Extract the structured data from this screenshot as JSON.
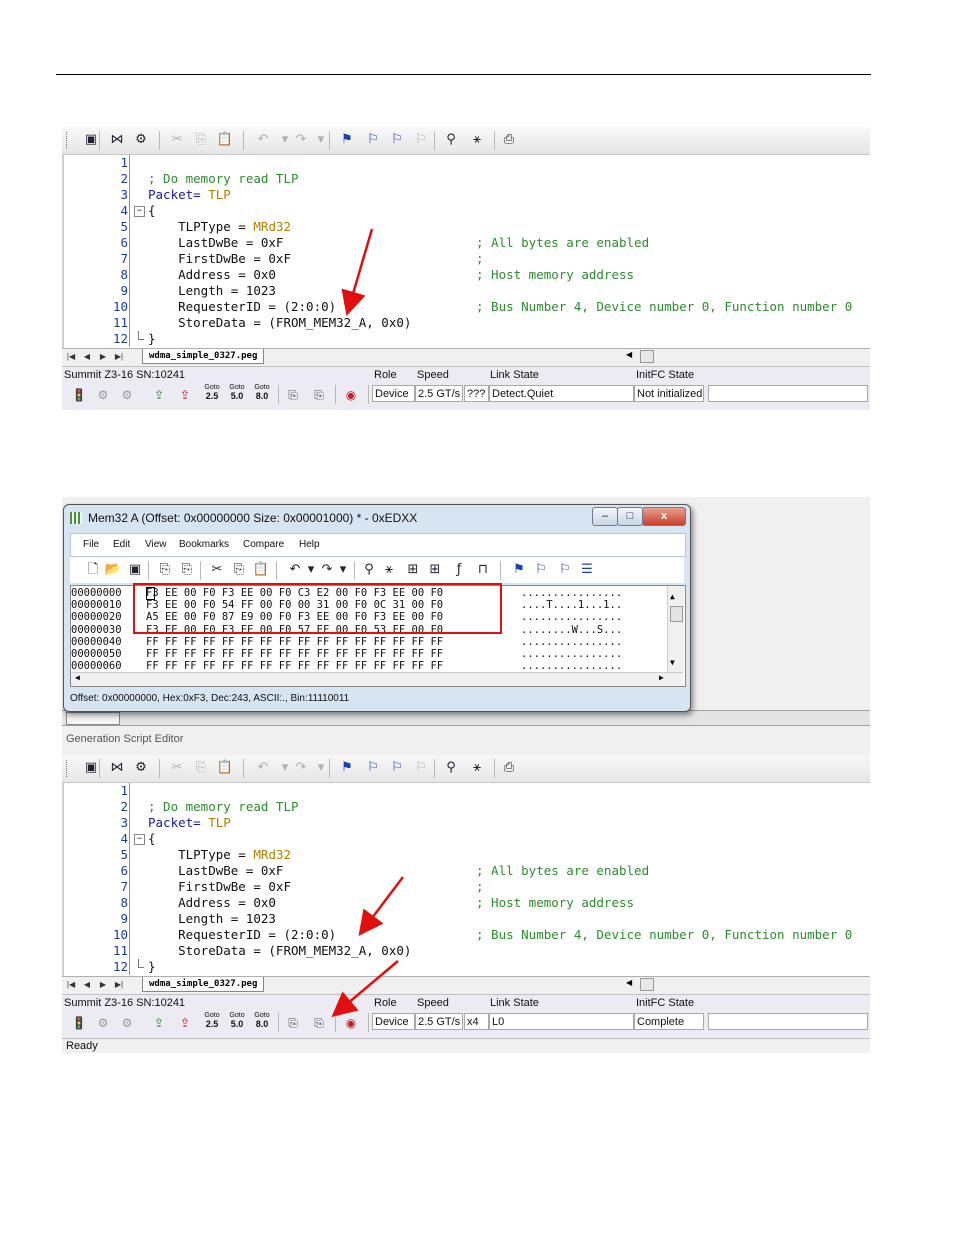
{
  "page": {
    "divider": true
  },
  "toolbar": {
    "icons": [
      "save-icon",
      "bowtie-icon",
      "build-icon",
      "cut-icon",
      "copy-icon",
      "paste-icon",
      "undo-icon",
      "undo-dropdown-icon",
      "redo-icon",
      "redo-dropdown-icon",
      "flag-icon",
      "flag-next-icon",
      "flag-prev-icon",
      "flag-clear-icon",
      "find-icon",
      "find-replace-icon",
      "print-icon"
    ]
  },
  "code": {
    "lines": [
      {
        "n": "1",
        "text": "",
        "comment": ""
      },
      {
        "n": "2",
        "text": "; Do memory read TLP",
        "comment": ""
      },
      {
        "n": "3",
        "text": "Packet= ",
        "value": "TLP",
        "comment": ""
      },
      {
        "n": "4",
        "text": "{",
        "comment": ""
      },
      {
        "n": "5",
        "text": "    TLPType = ",
        "value": "MRd32",
        "comment": ""
      },
      {
        "n": "6",
        "text": "    LastDwBe = 0xF",
        "comment": "; All bytes are enabled"
      },
      {
        "n": "7",
        "text": "    FirstDwBe = 0xF",
        "comment": ";"
      },
      {
        "n": "8",
        "text": "    Address = 0x0",
        "comment": "; Host memory address"
      },
      {
        "n": "9",
        "text": "    Length = 1023",
        "comment": ""
      },
      {
        "n": "10",
        "text": "    RequesterID = (2:0:0)",
        "comment": "; Bus Number 4, Device number 0, Function number 0"
      },
      {
        "n": "11",
        "text": "    StoreData = (FROM_MEM32_A, 0x0)",
        "comment": ""
      },
      {
        "n": "12",
        "text": "}",
        "comment": ""
      }
    ]
  },
  "file_tab": "wdma_simple_0327.peg",
  "analyzer": {
    "device_name": "Summit Z3-16 SN:10241",
    "goto_buttons": [
      {
        "top": "Goto",
        "bottom": "2.5"
      },
      {
        "top": "Goto",
        "bottom": "5.0"
      },
      {
        "top": "Goto",
        "bottom": "8.0"
      }
    ],
    "headers": {
      "role": "Role",
      "speed": "Speed",
      "link_state": "Link State",
      "initfc": "InitFC State"
    }
  },
  "status1": {
    "role": "Device",
    "speed": "2.5 GT/s",
    "width": "???",
    "link_state": "Detect.Quiet",
    "initfc": "Not initialized"
  },
  "status2": {
    "role": "Device",
    "speed": "2.5 GT/s",
    "width": "x4",
    "link_state": "L0",
    "initfc": "Complete"
  },
  "memwin": {
    "title": "Mem32 A (Offset: 0x00000000 Size: 0x00001000) * - 0xEDXX",
    "controls": {
      "minimize": "–",
      "maximize": "□",
      "close": "x"
    },
    "menu": [
      "File",
      "Edit",
      "View",
      "Bookmarks",
      "Compare",
      "Help"
    ],
    "rows": [
      {
        "offset": "00000000",
        "bytes": "F3 EE 00 F0 F3 EE 00 F0 C3 E2 00 F0 F3 EE 00 F0",
        "ascii": "................"
      },
      {
        "offset": "00000010",
        "bytes": "F3 EE 00 F0 54 FF 00 F0 00 31 00 F0 0C 31 00 F0",
        "ascii": "....T....1...1.."
      },
      {
        "offset": "00000020",
        "bytes": "A5 EE 00 F0 87 E9 00 F0 F3 EE 00 F0 F3 EE 00 F0",
        "ascii": "................"
      },
      {
        "offset": "00000030",
        "bytes": "F3 EE 00 F0 F3 EE 00 F0 57 EF 00 F0 53 FF 00 F0",
        "ascii": "........W...S..."
      },
      {
        "offset": "00000040",
        "bytes": "FF FF FF FF FF FF FF FF FF FF FF FF FF FF FF FF",
        "ascii": "................"
      },
      {
        "offset": "00000050",
        "bytes": "FF FF FF FF FF FF FF FF FF FF FF FF FF FF FF FF",
        "ascii": "................"
      },
      {
        "offset": "00000060",
        "bytes": "FF FF FF FF FF FF FF FF FF FF FF FF FF FF FF FF",
        "ascii": "................"
      }
    ],
    "status": "Offset: 0x00000000, Hex:0xF3, Dec:243, ASCII:., Bin:11110011"
  },
  "panel_title": "Generation Script Editor",
  "ready_text": "Ready",
  "colors": {
    "arrow": "#e01010",
    "highlight_box": "#e01010",
    "comment": "#2e8b2e",
    "value": "#b08000"
  }
}
